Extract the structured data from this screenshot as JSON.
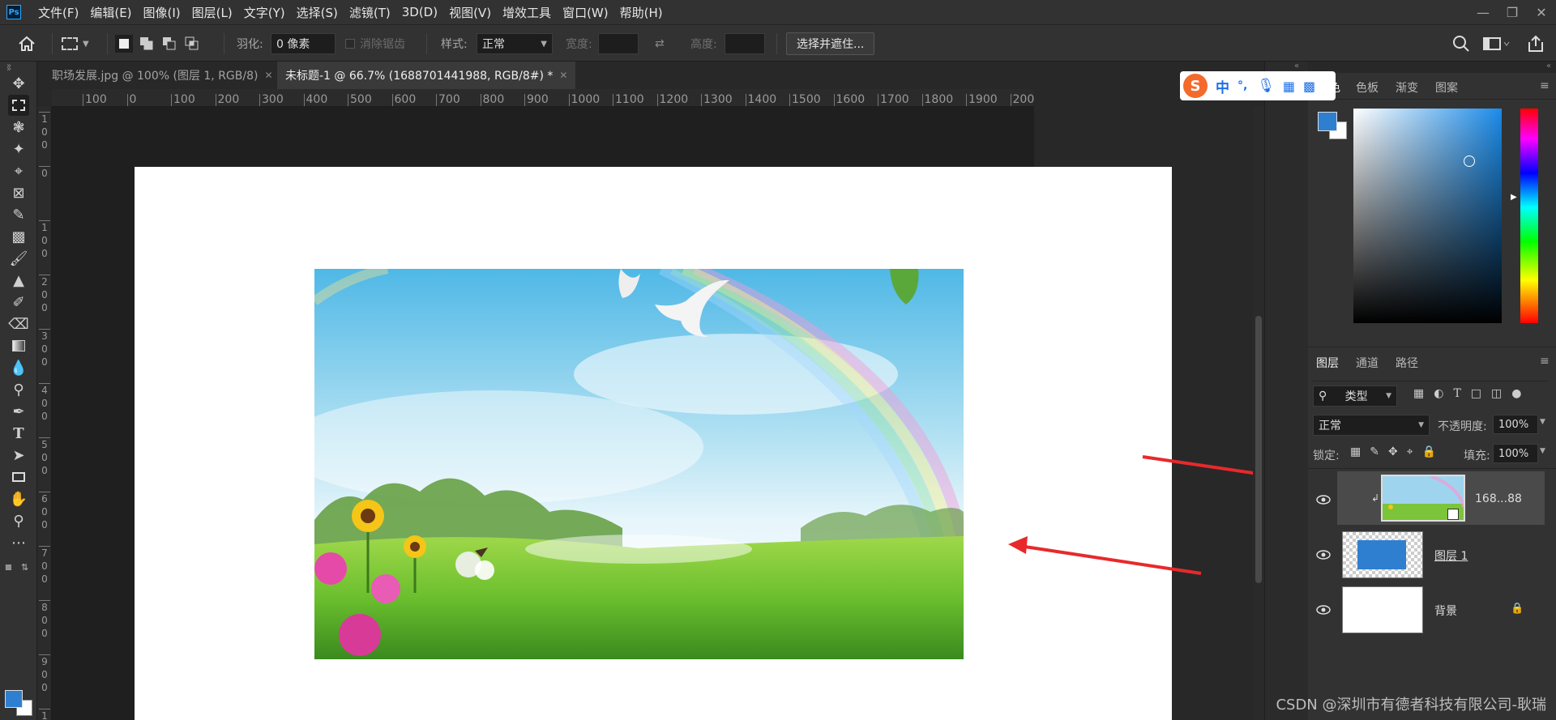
{
  "app": {
    "logo_text": "Ps"
  },
  "menus": [
    "文件(F)",
    "编辑(E)",
    "图像(I)",
    "图层(L)",
    "文字(Y)",
    "选择(S)",
    "滤镜(T)",
    "3D(D)",
    "视图(V)",
    "增效工具",
    "窗口(W)",
    "帮助(H)"
  ],
  "options": {
    "feather_label": "羽化:",
    "feather_value": "0 像素",
    "antialias_label": "消除锯齿",
    "style_label": "样式:",
    "style_value": "正常",
    "width_label": "宽度:",
    "height_label": "高度:",
    "select_mask_button": "选择并遮住..."
  },
  "tabs": [
    {
      "label": "职场发展.jpg @ 100% (图层 1, RGB/8)",
      "active": false
    },
    {
      "label": "未标题-1 @ 66.7% (1688701441988, RGB/8#) *",
      "active": true
    }
  ],
  "ruler_top": [
    "100",
    "0",
    "100",
    "200",
    "300",
    "400",
    "500",
    "600",
    "700",
    "800",
    "900",
    "1000",
    "1100",
    "1200",
    "1300",
    "1400",
    "1500",
    "1600",
    "1700",
    "1800",
    "1900",
    "2000"
  ],
  "ruler_left": [
    "1\n0\n0",
    "0",
    "1\n0\n0",
    "2\n0\n0",
    "3\n0\n0",
    "4\n0\n0",
    "5\n0\n0",
    "6\n0\n0",
    "7\n0\n0",
    "8\n0\n0",
    "9\n0\n0",
    "1"
  ],
  "ime": {
    "logo": "S",
    "mode": "中",
    "punct": "°,"
  },
  "color_panel": {
    "tabs": [
      "色板",
      "渐变",
      "图案"
    ],
    "fg_color": "#2f7fd0",
    "bg_color": "#ffffff"
  },
  "layers_panel": {
    "tabs": [
      "图层",
      "通道",
      "路径"
    ],
    "filter_kind": "类型",
    "blend_mode": "正常",
    "opacity_label": "不透明度:",
    "opacity_value": "100%",
    "lock_label": "锁定:",
    "fill_label": "填充:",
    "fill_value": "100%",
    "layers": [
      {
        "name": "168...88",
        "type": "smart-object",
        "visible": true,
        "selected": true
      },
      {
        "name": "图层 1",
        "type": "pixel",
        "visible": true,
        "selected": false,
        "fill_color": "#2f7fd0"
      },
      {
        "name": "背景",
        "type": "background",
        "visible": true,
        "locked": true,
        "fill_color": "#ffffff"
      }
    ]
  },
  "watermark": "CSDN @深圳市有德者科技有限公司-耿瑞",
  "annotation_color": "#e8292b"
}
